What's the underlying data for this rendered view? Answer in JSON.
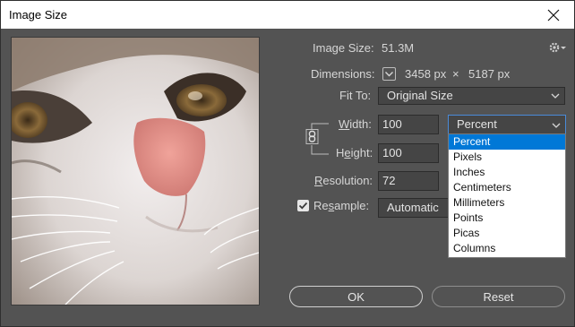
{
  "window": {
    "title": "Image Size",
    "close_icon": "close-icon"
  },
  "info": {
    "image_size_label": "Image Size:",
    "image_size_value": "51.3M",
    "dimensions_label": "Dimensions:",
    "dim_width": "3458 px",
    "dim_times": "×",
    "dim_height": "5187 px",
    "fit_to_label": "Fit To:",
    "fit_to_value": "Original Size"
  },
  "fields": {
    "width_label": "Width:",
    "width_value": "100",
    "width_unit": "Percent",
    "height_label": "Height:",
    "height_value": "100",
    "resolution_label_first": "R",
    "resolution_label_rest": "esolution:",
    "resolution_value": "72",
    "resample_label_first": "Re",
    "resample_label_u": "s",
    "resample_label_rest": "ample:",
    "resample_value": "Automatic",
    "resample_checked": true
  },
  "unit_options": [
    "Percent",
    "Pixels",
    "Inches",
    "Centimeters",
    "Millimeters",
    "Points",
    "Picas",
    "Columns"
  ],
  "unit_selected_index": 0,
  "buttons": {
    "ok": "OK",
    "reset": "Reset"
  },
  "colors": {
    "background": "#535353",
    "highlight": "#0078d7",
    "titlebar": "#ffffff"
  }
}
